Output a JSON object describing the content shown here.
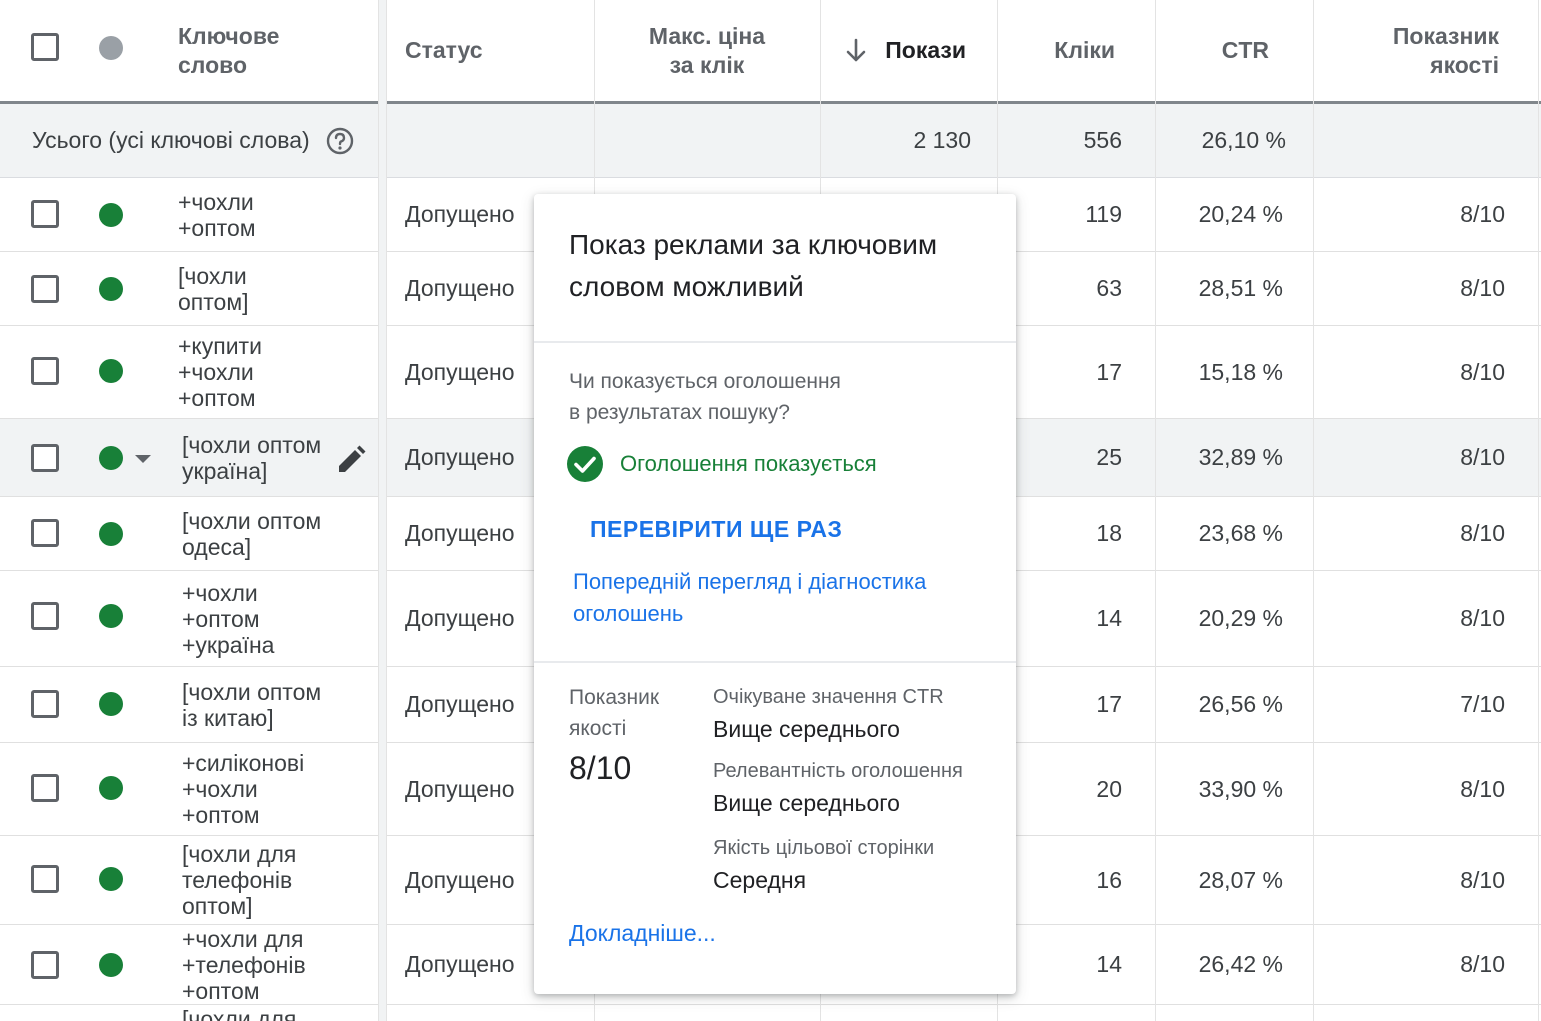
{
  "header": {
    "keyword": "Ключове\nслово",
    "status": "Статус",
    "max_cpc": "Макс. ціна\nза клік",
    "impressions": "Покази",
    "clicks": "Кліки",
    "ctr": "CTR",
    "quality": "Показник\nякості"
  },
  "total": {
    "label": "Усього (усі ключові слова)",
    "impressions": "2 130",
    "clicks": "556",
    "ctr": "26,10 %"
  },
  "rows": [
    {
      "keyword": "+чохли\n+оптом",
      "status": "Допущено",
      "clicks": "119",
      "ctr": "20,24 %",
      "quality": "8/10"
    },
    {
      "keyword": "[чохли\nоптом]",
      "status": "Допущено",
      "clicks": "63",
      "ctr": "28,51 %",
      "quality": "8/10"
    },
    {
      "keyword": "+купити\n+чохли\n+оптом",
      "status": "Допущено",
      "clicks": "17",
      "ctr": "15,18 %",
      "quality": "8/10"
    },
    {
      "keyword": "[чохли оптом\nукраїна]",
      "status": "Допущено",
      "clicks": "25",
      "ctr": "32,89 %",
      "quality": "8/10"
    },
    {
      "keyword": "[чохли оптом\nодеса]",
      "status": "Допущено",
      "clicks": "18",
      "ctr": "23,68 %",
      "quality": "8/10"
    },
    {
      "keyword": "+чохли\n+оптом\n+україна",
      "status": "Допущено",
      "clicks": "14",
      "ctr": "20,29 %",
      "quality": "8/10"
    },
    {
      "keyword": "[чохли оптом\nіз китаю]",
      "status": "Допущено",
      "clicks": "17",
      "ctr": "26,56 %",
      "quality": "7/10"
    },
    {
      "keyword": "+силіконові\n+чохли\n+оптом",
      "status": "Допущено",
      "clicks": "20",
      "ctr": "33,90 %",
      "quality": "8/10"
    },
    {
      "keyword": "[чохли для\nтелефонів\nоптом]",
      "status": "Допущено",
      "clicks": "16",
      "ctr": "28,07 %",
      "quality": "8/10"
    },
    {
      "keyword": "+чохли для\n+телефонів\n+оптом",
      "status": "Допущено",
      "clicks": "14",
      "ctr": "26,42 %",
      "quality": "8/10"
    },
    {
      "keyword": "[чохли для",
      "status": "",
      "clicks": "",
      "ctr": "",
      "quality": ""
    }
  ],
  "popup": {
    "title": "Показ реклами за ключовим словом можливий",
    "question": "Чи показується оголошення\nв результатах пошуку?",
    "status": "Оголошення показується",
    "recheck": "ПЕРЕВІРИТИ ЩЕ РАЗ",
    "preview_link": "Попередній перегляд і діагностика оголошень",
    "quality_label": "Показник\nякості",
    "quality_value": "8/10",
    "ctr_label": "Очікуване значення CTR",
    "ctr_value": "Вище середнього",
    "relevance_label": "Релевантність оголошення",
    "relevance_value": "Вище середнього",
    "landing_label": "Якість цільової сторінки",
    "landing_value": "Середня",
    "more_link": "Докладніше..."
  },
  "colors": {
    "accent": "#1a73e8",
    "status_green": "#188038",
    "header_text": "#5f6368"
  },
  "icons": [
    "sort-down-icon",
    "help-icon",
    "edit-pencil-icon",
    "dropdown-caret-icon",
    "check-circle-icon"
  ]
}
